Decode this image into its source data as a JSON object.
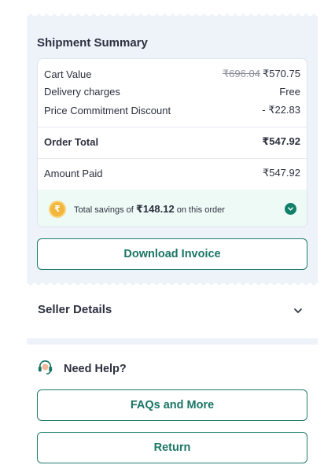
{
  "shipment_summary": {
    "title": "Shipment Summary",
    "cart_value_label": "Cart Value",
    "cart_value_original": "₹696.04",
    "cart_value_final": "₹570.75",
    "delivery_label": "Delivery charges",
    "delivery_value": "Free",
    "discount_label": "Price Commitment Discount",
    "discount_value": "- ₹22.83",
    "order_total_label": "Order Total",
    "order_total_value": "₹547.92",
    "amount_paid_label": "Amount Paid",
    "amount_paid_value": "₹547.92",
    "savings_prefix": "Total savings of",
    "savings_amount": "₹148.12",
    "savings_suffix": "on this order",
    "coin_symbol": "₹",
    "download_invoice_label": "Download Invoice"
  },
  "seller_details": {
    "title": "Seller Details"
  },
  "help": {
    "title": "Need Help?",
    "faqs_label": "FAQs and More",
    "return_label": "Return"
  },
  "colors": {
    "accent": "#1a7566",
    "card_bg": "#eef3fa",
    "savings_bg": "#eefaf6",
    "coin": "#f3b63c"
  },
  "icons": {
    "coin": "rupee-coin-icon",
    "check": "check-circle-icon",
    "chevron": "chevron-down-icon",
    "help": "headset-support-icon"
  }
}
